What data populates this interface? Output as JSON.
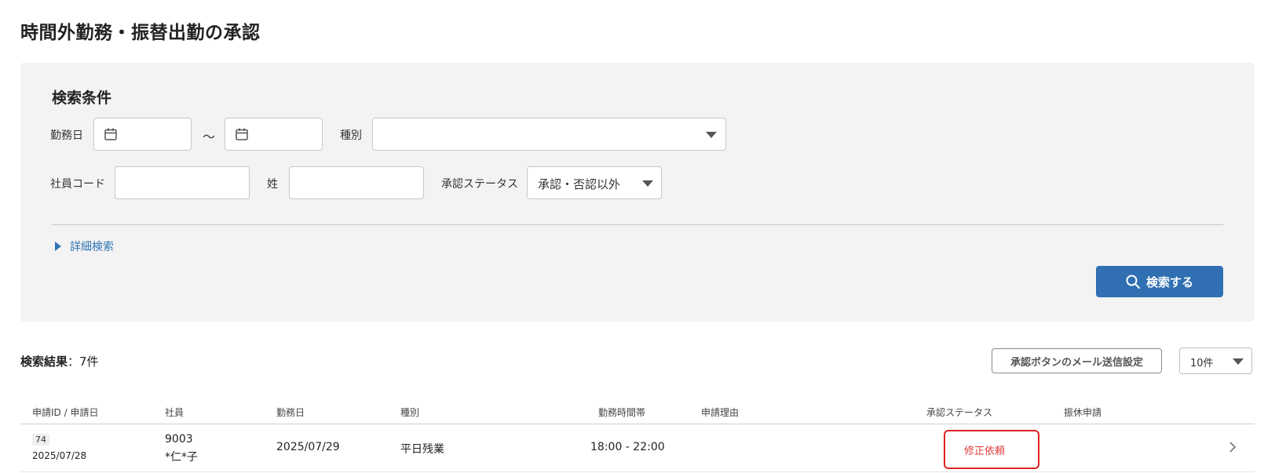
{
  "page": {
    "title": "時間外勤務・振替出勤の承認"
  },
  "search": {
    "title": "検索条件",
    "work_date_label": "勤務日",
    "range_separator": "～",
    "type_label": "種別",
    "type_value": "",
    "employee_code_label": "社員コード",
    "employee_code_value": "",
    "last_name_label": "姓",
    "last_name_value": "",
    "approval_status_label": "承認ステータス",
    "approval_status_value": "承認・否認以外",
    "advanced_search_label": "詳細検索",
    "search_button_label": "検索する"
  },
  "results": {
    "count_label": "検索結果",
    "count_value": "：7件",
    "mail_settings_button": "承認ボタンのメール送信設定",
    "per_page_value": "10件"
  },
  "table": {
    "headers": [
      "申請ID / 申請日",
      "社員",
      "勤務日",
      "種別",
      "勤務時間帯",
      "申請理由",
      "承認ステータス",
      "振休申請"
    ],
    "rows": [
      {
        "id": "74",
        "applied_date": "2025/07/28",
        "employee_code": "9003",
        "employee_name": "*仁*子",
        "work_date": "2025/07/29",
        "type": "平日残業",
        "time_range": "18:00 - 22:00",
        "reason": "",
        "status": "修正依頼",
        "comp_leave": ""
      }
    ]
  },
  "colors": {
    "primary_button": "#2f6fb2",
    "link": "#2f74b5",
    "status_red": "#e03c3c",
    "highlight_box": "#e02020",
    "panel_bg": "#f3f3f3"
  }
}
